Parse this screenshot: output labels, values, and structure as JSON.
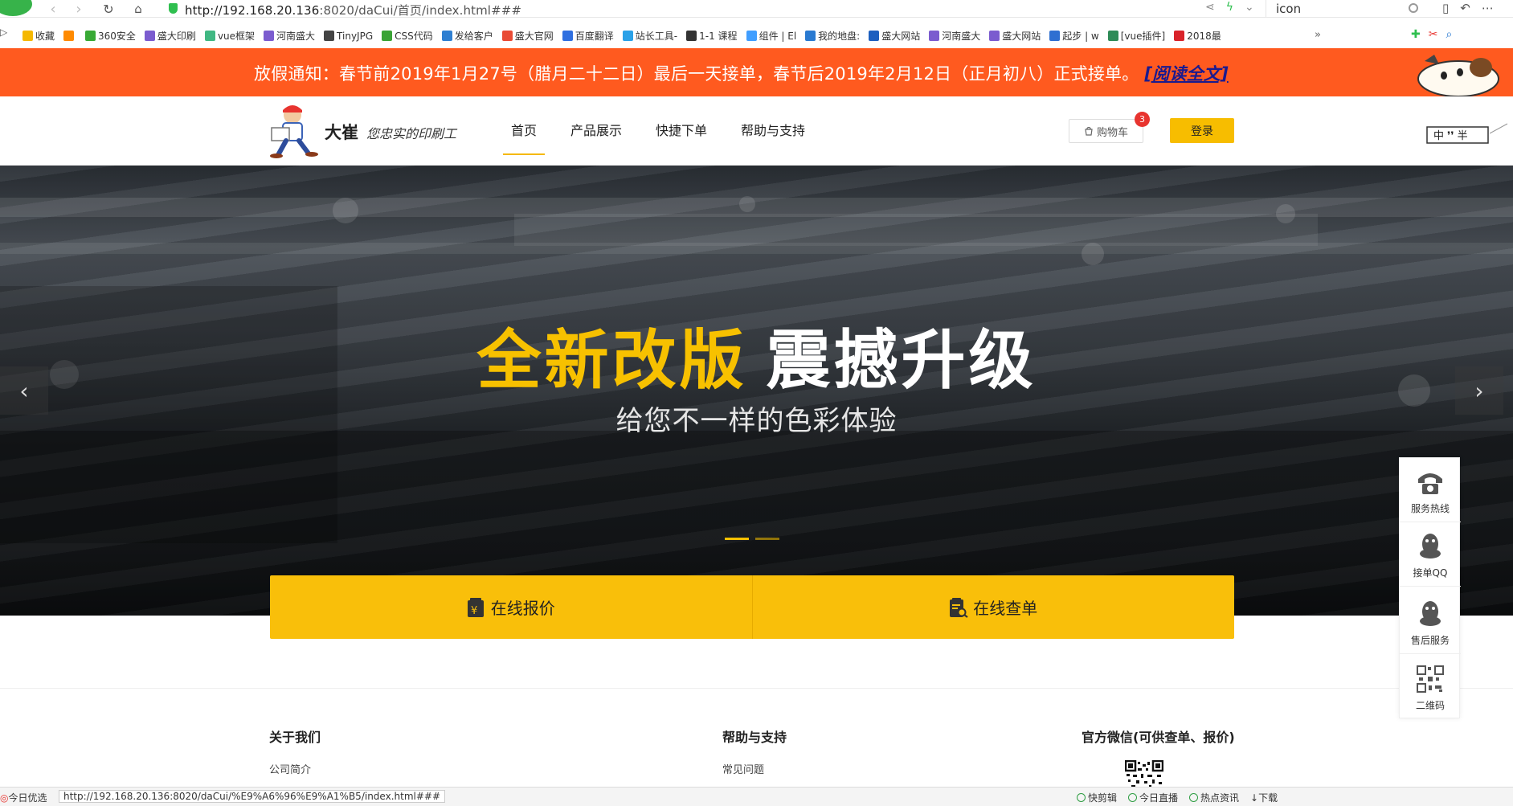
{
  "browser": {
    "url_host": "http://192.168.20.136",
    "url_path": ":8020/daCui/首页/index.html###",
    "search_text": "icon"
  },
  "bookmarks": [
    {
      "label": "收藏",
      "color": "#f5b800"
    },
    {
      "label": "",
      "color": "#ff8a00"
    },
    {
      "label": "360安全",
      "color": "#38a935"
    },
    {
      "label": "盛大印刷",
      "color": "#7b5ccf"
    },
    {
      "label": "vue框架",
      "color": "#41b883"
    },
    {
      "label": "河南盛大",
      "color": "#7b5ccf"
    },
    {
      "label": "TinyJPG",
      "color": "#444444"
    },
    {
      "label": "CSS代码",
      "color": "#3aa335"
    },
    {
      "label": "发给客户",
      "color": "#2f7fd1"
    },
    {
      "label": "盛大官网",
      "color": "#e94b35"
    },
    {
      "label": "百度翻译",
      "color": "#2f6fe0"
    },
    {
      "label": "站长工具-",
      "color": "#2aa1e8"
    },
    {
      "label": "1-1 课程",
      "color": "#333333"
    },
    {
      "label": "组件 | El",
      "color": "#409eff"
    },
    {
      "label": "我的地盘:",
      "color": "#2a7ad1"
    },
    {
      "label": "盛大网站",
      "color": "#1d5fbf"
    },
    {
      "label": "河南盛大",
      "color": "#7b5ccf"
    },
    {
      "label": "盛大网站",
      "color": "#7b5ccf"
    },
    {
      "label": "起步 | w",
      "color": "#2f6fd1"
    },
    {
      "label": "[vue插件]",
      "color": "#2e8b57"
    },
    {
      "label": "2018最",
      "color": "#d9232a"
    }
  ],
  "notice": {
    "text": "放假通知：春节前2019年1月27号（腊月二十二日）最后一天接单，春节后2019年2月12日（正月初八）正式接单。",
    "link": "[阅读全文]"
  },
  "header": {
    "brand": "大崔",
    "slogan": "您忠实的印刷工",
    "nav": [
      "首页",
      "产品展示",
      "快捷下单",
      "帮助与支持"
    ],
    "cart_label": "购物车",
    "cart_count": "3",
    "login_label": "登录"
  },
  "hero": {
    "headline_yellow": "全新改版",
    "headline_white": "震撼升级",
    "subtitle": "给您不一样的色彩体验",
    "prev": "‹",
    "next": "›"
  },
  "actions": {
    "quote": "在线报价",
    "query": "在线查单"
  },
  "footer": {
    "about_title": "关于我们",
    "about_link": "公司简介",
    "help_title": "帮助与支持",
    "help_link": "常见问题",
    "wechat_title": "官方微信(可供查单、报价)"
  },
  "side_panel": {
    "hotline": "服务热线",
    "qq": "接单QQ",
    "aftersale": "售后服务",
    "qrcode": "二维码"
  },
  "statusbar": {
    "left": "今日优选",
    "url": "http://192.168.20.136:8020/daCui/%E9%A6%96%E9%A1%B5/index.html###",
    "items": [
      "快剪辑",
      "今日直播",
      "热点资讯",
      "下载"
    ]
  },
  "colors": {
    "notice_bg": "#ff5a1f",
    "accent_yellow": "#f7bd00",
    "badge_red": "#e8342f"
  }
}
